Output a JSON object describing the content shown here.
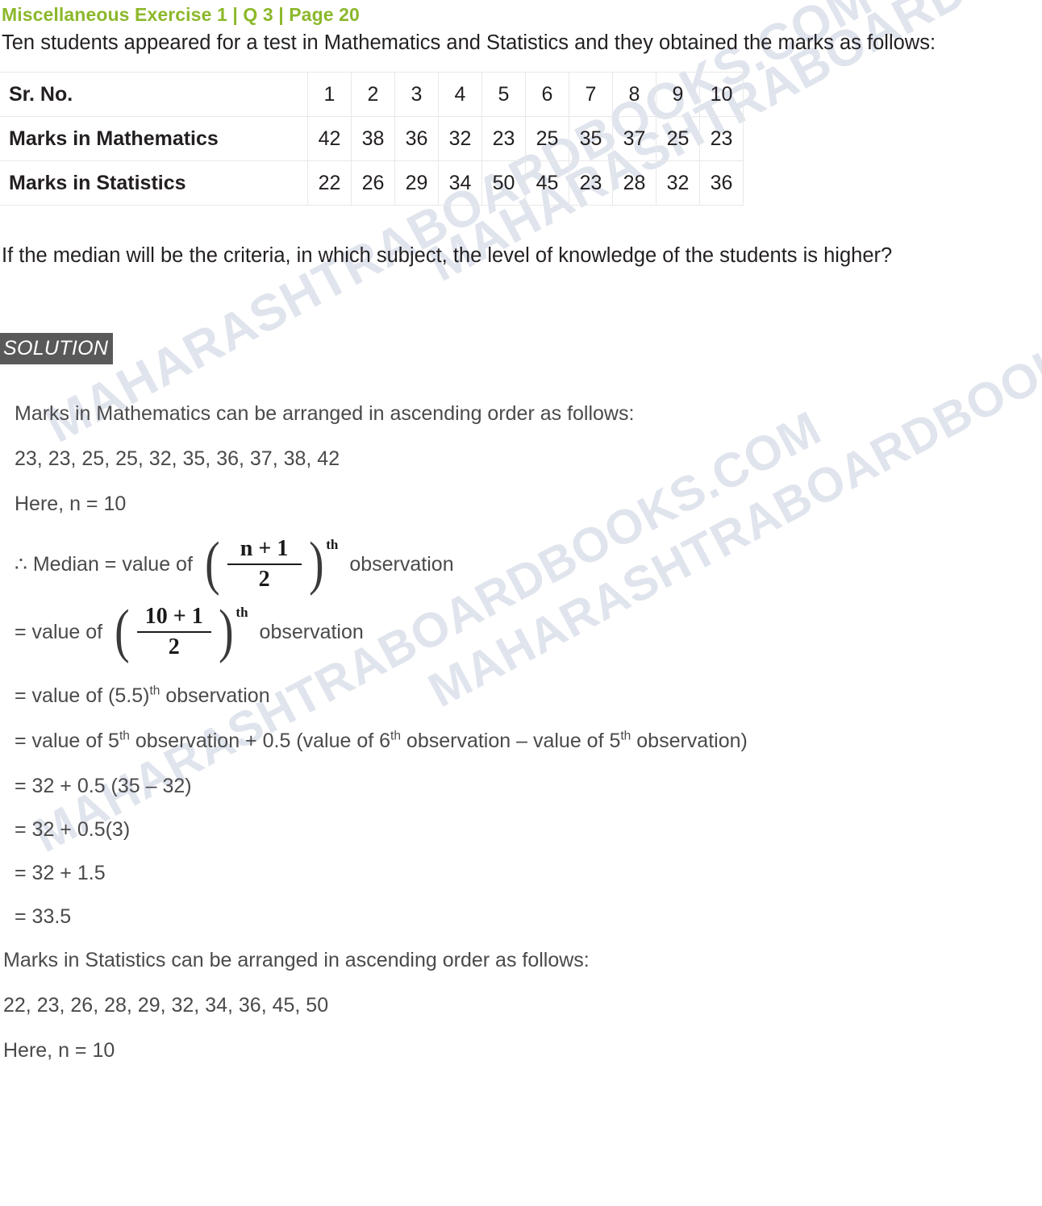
{
  "header": {
    "title": "Miscellaneous Exercise 1 | Q 3 | Page 20",
    "title_color": "#8cb82b"
  },
  "question": {
    "intro": "Ten students appeared for a test in Mathematics and Statistics and they obtained the marks as follows:",
    "tail": "If the median will be the criteria, in which subject, the level of knowledge of the students is higher?"
  },
  "table": {
    "rows": [
      {
        "label": "Sr. No.",
        "values": [
          "1",
          "2",
          "3",
          "4",
          "5",
          "6",
          "7",
          "8",
          "9",
          "10"
        ]
      },
      {
        "label": "Marks in Mathematics",
        "values": [
          "42",
          "38",
          "36",
          "32",
          "23",
          "25",
          "35",
          "37",
          "25",
          "23"
        ]
      },
      {
        "label": "Marks in Statistics",
        "values": [
          "22",
          "26",
          "29",
          "34",
          "50",
          "45",
          "23",
          "28",
          "32",
          "36"
        ]
      }
    ]
  },
  "solution": {
    "badge": "SOLUTION",
    "math_intro": "Marks in Mathematics can be arranged in ascending order as follows:",
    "math_sorted": "23, 23, 25, 25, 32, 35, 36, 37, 38, 42",
    "math_n": "Here, n = 10",
    "formula1": {
      "lead": "∴ Median = value of",
      "numerator": "n + 1",
      "denominator": "2",
      "sup": "th",
      "trail": "observation"
    },
    "formula2": {
      "lead": "= value of",
      "numerator": "10 + 1",
      "denominator": "2",
      "sup": "th",
      "trail": "observation"
    },
    "step_55_pre": "= value of (5.5)",
    "step_55_sup": "th",
    "step_55_post": " observation",
    "step_expand": [
      {
        "pre": "= value of 5",
        "sup": "th",
        "post": " observation + 0.5 (value of 6"
      },
      {
        "sup": "th",
        "post": " observation – value of 5"
      },
      {
        "sup": "th",
        "post": " observation)"
      }
    ],
    "steps": [
      "= 32 + 0.5 (35 – 32)",
      "= 32 + 0.5(3)",
      "= 32 + 1.5",
      "= 33.5"
    ],
    "stat_intro": "Marks in Statistics can be arranged in ascending order as follows:",
    "stat_sorted": "22, 23, 26, 28, 29, 32, 34, 36, 45, 50",
    "stat_n": "Here, n = 10"
  },
  "watermark": {
    "text": "MAHARASHTRABOARDBOOKS.COM",
    "color": "#c8cfe0"
  }
}
